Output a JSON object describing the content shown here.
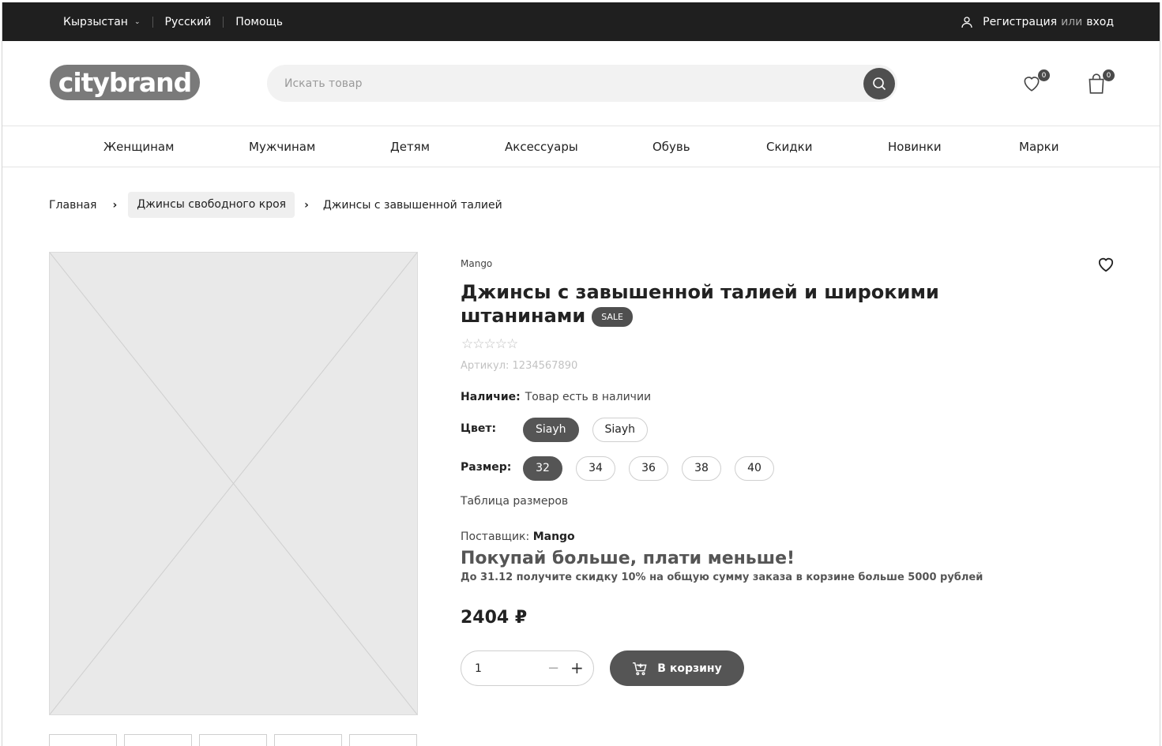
{
  "topbar": {
    "country": "Кырзыстан",
    "language": "Русский",
    "help": "Помощь",
    "register": "Регистрация",
    "or": "или",
    "login": "вход"
  },
  "header": {
    "logo": "citybrand",
    "search_placeholder": "Искать товар",
    "wishlist_count": "0",
    "cart_count": "0"
  },
  "nav": {
    "items": [
      "Женщинам",
      "Мужчинам",
      "Детям",
      "Аксессуары",
      "Обувь",
      "Скидки",
      "Новинки",
      "Марки"
    ]
  },
  "breadcrumb": {
    "items": [
      "Главная",
      "Джинсы свободного кроя",
      "Джинсы с завышенной талией"
    ],
    "separator": "›"
  },
  "product": {
    "brand": "Mango",
    "title": "Джинсы с завышенной талией и широкими штанинами",
    "sale_badge": "SALE",
    "stars": "☆☆☆☆☆",
    "rating": 0,
    "sku": "Артикул: 1234567890",
    "availability_label": "Наличие:",
    "availability_value": "Товар есть в наличии",
    "color_label": "Цвет:",
    "colors": [
      "Siayh",
      "Siayh"
    ],
    "size_label": "Размер:",
    "sizes": [
      "32",
      "34",
      "36",
      "38",
      "40"
    ],
    "size_table": "Таблица размеров",
    "supplier_label": "Поставщик:",
    "supplier_value": "Mango",
    "promo_title": "Покупай больше, плати меньше!",
    "promo_text": "До 31.12 получите скидку 10% на общую сумму заказа в корзине больше 5000 рублей",
    "price": "2404 ₽",
    "quantity": "1",
    "minus": "−",
    "plus": "+",
    "add_to_cart": "В корзину"
  },
  "colors": {
    "topbar_bg": "#1f1f1f",
    "accent": "#555555",
    "placeholder_bg": "#e9e9e9"
  }
}
